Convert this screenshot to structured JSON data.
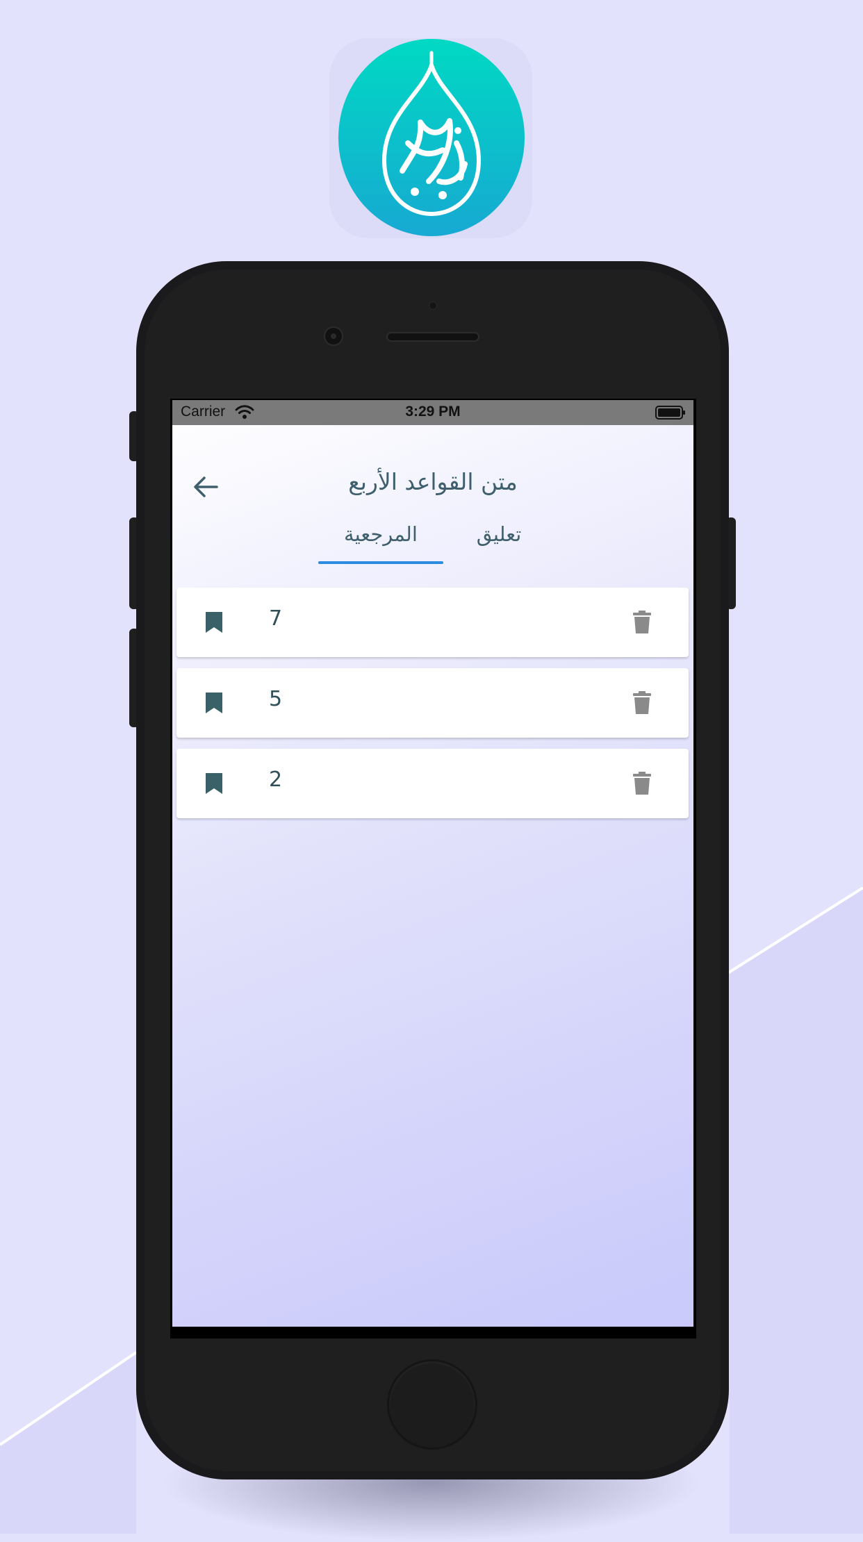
{
  "app_icon": {
    "name": "app-logo",
    "colors": {
      "top": "#00d9c3",
      "bottom": "#17a9d2",
      "glyph": "#ffffff"
    }
  },
  "status_bar": {
    "carrier": "Carrier",
    "time": "3:29 PM"
  },
  "header": {
    "back_icon": "arrow-left-icon",
    "title": "متن القواعد الأربع"
  },
  "tabs": [
    {
      "label": "المرجعية",
      "selected": true
    },
    {
      "label": "تعليق",
      "selected": false
    }
  ],
  "bookmarks": [
    {
      "number": "7",
      "icon": "bookmark-icon",
      "action_icon": "trash-icon"
    },
    {
      "number": "5",
      "icon": "bookmark-icon",
      "action_icon": "trash-icon"
    },
    {
      "number": "2",
      "icon": "bookmark-icon",
      "action_icon": "trash-icon"
    }
  ],
  "colors": {
    "accent": "#2d8ce0",
    "text": "#3e5f6b",
    "bookmark_icon": "#3a6068",
    "trash_icon": "#8a8a8a",
    "page_background": "#e3e2fc"
  }
}
